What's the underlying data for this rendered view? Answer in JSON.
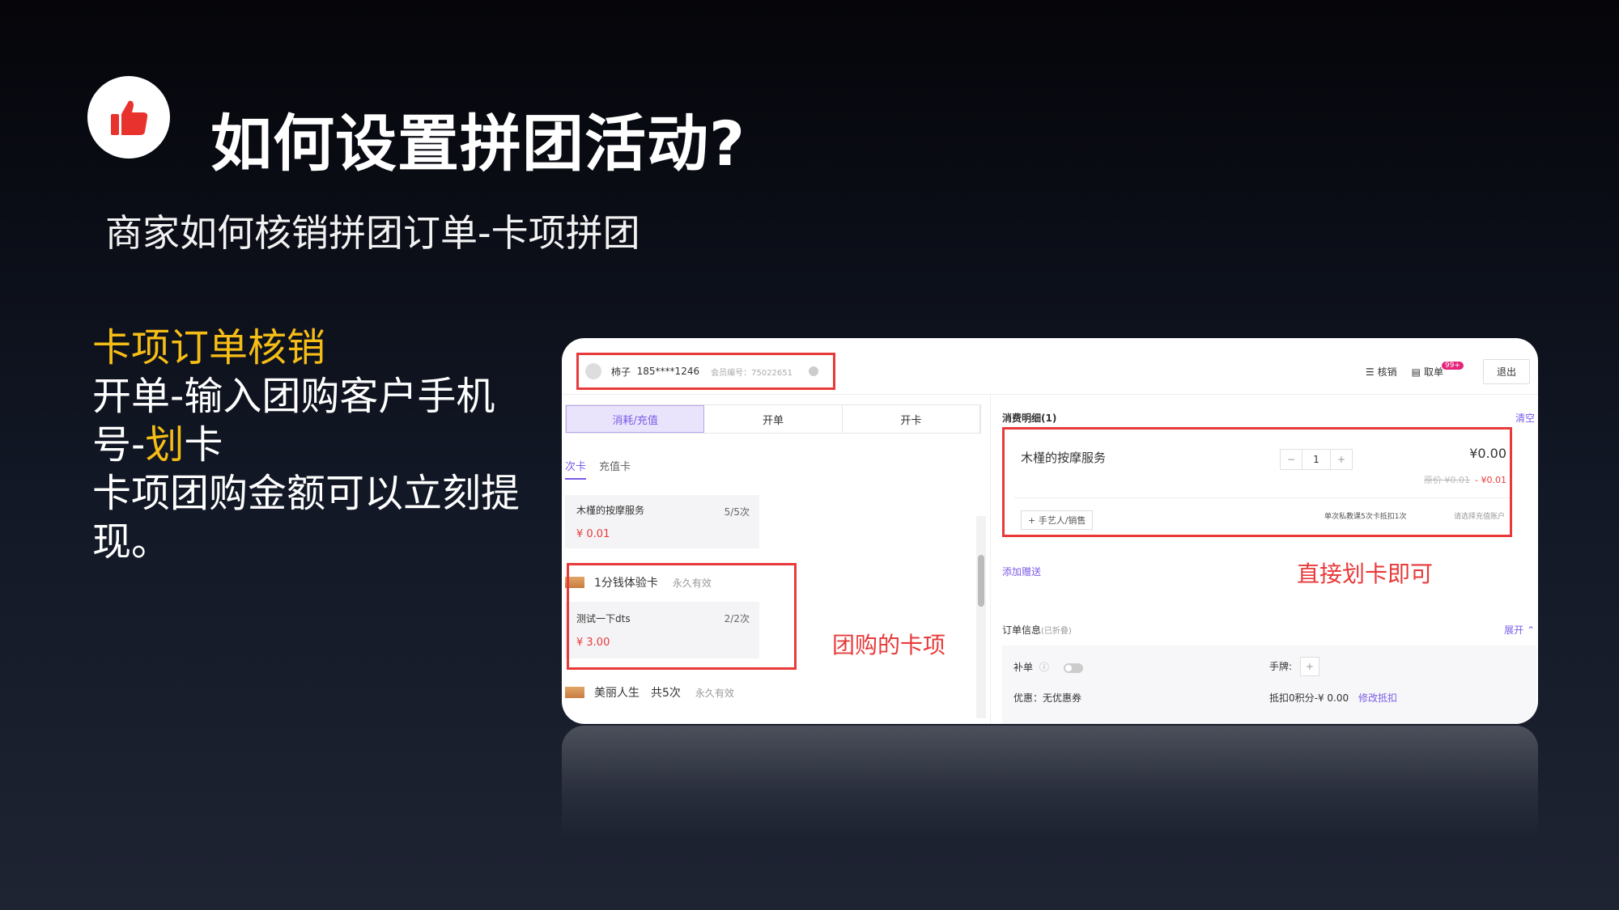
{
  "header": {
    "icon": "thumbs-up-icon",
    "title": "如何设置拼团活动?",
    "subtitle": "商家如何核销拼团订单-卡项拼团"
  },
  "left_text": {
    "heading": "卡项订单核销",
    "line1_part1": "开单-输入团购客户手机号-",
    "line1_highlight": "划",
    "line1_part2": "卡",
    "line2": "卡项团购金额可以立刻提现。"
  },
  "colors": {
    "accent": "#f6bd16",
    "annotation_red": "#e83a3a",
    "ui_purple": "#7b5ce6",
    "logo_red": "#e8322e"
  },
  "screenshot": {
    "user": {
      "name": "柿子",
      "phone": "185****1246",
      "member_no": "会员编号：75022651"
    },
    "topbar": {
      "verify": "核销",
      "pending": "取单",
      "badge": "99+",
      "exit": "退出"
    },
    "tabs": [
      "消耗/充值",
      "开单",
      "开卡"
    ],
    "subtabs": [
      "次卡",
      "充值卡"
    ],
    "card1": {
      "name": "木槿的按摩服务",
      "count": "5/5次",
      "price": "¥ 0.01"
    },
    "category1": {
      "name": "1分钱体验卡",
      "validity": "永久有效"
    },
    "card2": {
      "name": "测试一下dts",
      "count": "2/2次",
      "price": "¥ 3.00"
    },
    "category2": {
      "name": "美丽人生　共5次",
      "validity": "永久有效"
    },
    "label_group_card": "团购的卡项",
    "detail": {
      "title": "消费明细(1)",
      "clear": "清空",
      "service": "木槿的按摩服务",
      "qty": "1",
      "amount": "¥0.00",
      "orig_price": "原价 ¥0.01",
      "discount": "- ¥0.01",
      "add_staff": "+ 手艺人/销售",
      "card_select": "单次私教课5次卡抵扣1次",
      "account_select": "请选择充值账户",
      "add_gift": "添加赠送",
      "label_direct": "直接划卡即可",
      "order_info": "订单信息",
      "order_info_note": "(已折叠)",
      "expand": "展开",
      "supplement": "补单",
      "fee": "手牌:",
      "promo": "优惠：无优惠券",
      "points": "抵扣0积分-¥ 0.00",
      "edit_deduct": "修改抵扣"
    }
  }
}
